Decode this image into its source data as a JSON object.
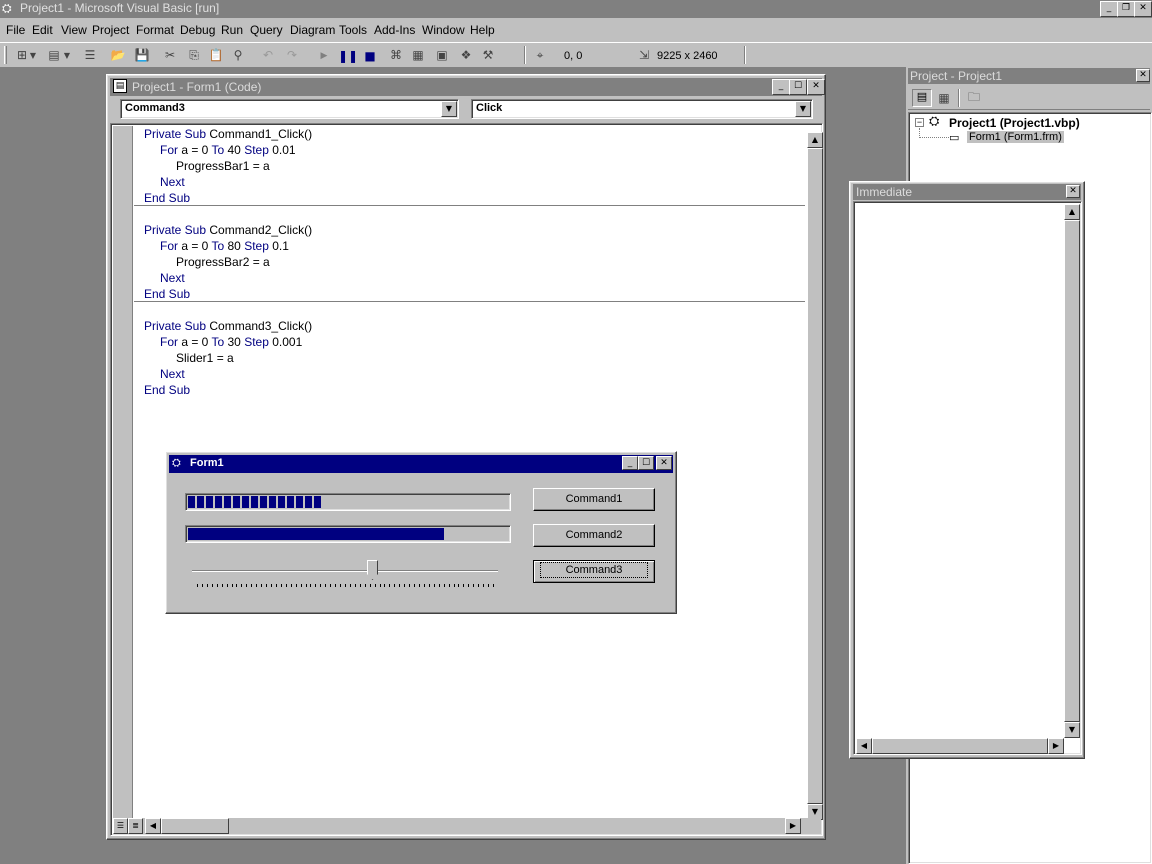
{
  "app": {
    "title": "Project1 - Microsoft Visual Basic [run]"
  },
  "menu": [
    "File",
    "Edit",
    "View",
    "Project",
    "Format",
    "Debug",
    "Run",
    "Query",
    "Diagram",
    "Tools",
    "Add-Ins",
    "Window",
    "Help"
  ],
  "toolbar": {
    "position": "0, 0",
    "size": "9225 x 2460"
  },
  "code_window": {
    "title": "Project1 - Form1 (Code)",
    "object": "Command3",
    "procedure": "Click",
    "lines": [
      "Private Sub Command1_Click()",
      "For a = 0 To 40 Step 0.01",
      "ProgressBar1 = a",
      "Next",
      "End Sub",
      "Private Sub Command2_Click()",
      "For a = 0 To 80 Step 0.1",
      "ProgressBar2 = a",
      "Next",
      "End Sub",
      "Private Sub Command3_Click()",
      "For a = 0 To 30 Step 0.001",
      "Slider1 = a",
      "Next",
      "End Sub"
    ]
  },
  "form1": {
    "title": "Form1",
    "progress1": 0.42,
    "progress2": 0.8,
    "slider": 0.59,
    "command1": "Command1",
    "command2": "Command2",
    "command3": "Command3"
  },
  "project": {
    "title": "Project - Project1",
    "root": "Project1 (Project1.vbp)",
    "child": "Form1 (Form1.frm)"
  },
  "immediate": {
    "title": "Immediate"
  },
  "colors": {
    "titlebar_active": "#000080",
    "titlebar_inactive": "#808080",
    "face": "#c0c0c0",
    "keyword": "#000080"
  }
}
